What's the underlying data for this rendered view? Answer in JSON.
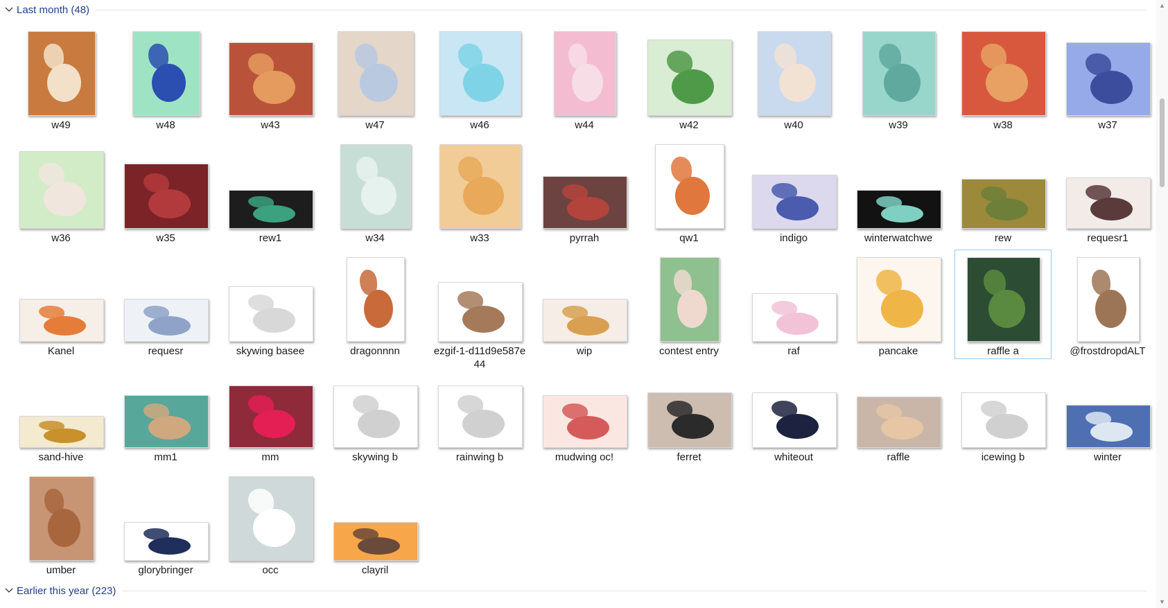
{
  "groups": [
    {
      "label": "Last month (48)"
    },
    {
      "label": "Earlier this year (223)"
    }
  ],
  "icons": {
    "group_toggle": "chevron-down-icon",
    "scroll_up": "chevron-up-icon",
    "scroll_down": "chevron-down-icon"
  },
  "selected_item": "raffle a",
  "items": [
    {
      "name": "w49",
      "bg": "#c97a3f",
      "fg": "#f2e0c8",
      "w": 98,
      "h": 122
    },
    {
      "name": "w48",
      "bg": "#9ee3c4",
      "fg": "#2a4fb0",
      "w": 98,
      "h": 122
    },
    {
      "name": "w43",
      "bg": "#b8533a",
      "fg": "#e59a5e",
      "w": 122,
      "h": 106
    },
    {
      "name": "w47",
      "bg": "#e4d6c8",
      "fg": "#b9c9e0",
      "w": 110,
      "h": 122
    },
    {
      "name": "w46",
      "bg": "#c8e6f4",
      "fg": "#7fd3e6",
      "w": 118,
      "h": 122
    },
    {
      "name": "w44",
      "bg": "#f3bcd0",
      "fg": "#f7dde6",
      "w": 90,
      "h": 122
    },
    {
      "name": "w42",
      "bg": "#d9ecd4",
      "fg": "#4f9a48",
      "w": 122,
      "h": 110
    },
    {
      "name": "w40",
      "bg": "#c9d9ee",
      "fg": "#f1e2d4",
      "w": 106,
      "h": 122
    },
    {
      "name": "w39",
      "bg": "#98d6cb",
      "fg": "#5fa99f",
      "w": 106,
      "h": 122
    },
    {
      "name": "w38",
      "bg": "#d8583e",
      "fg": "#e8a163",
      "w": 122,
      "h": 122
    },
    {
      "name": "w37",
      "bg": "#96a9e8",
      "fg": "#3d4d9e",
      "w": 122,
      "h": 106
    },
    {
      "name": "w36",
      "bg": "#d3ecc8",
      "fg": "#f0e6de",
      "w": 122,
      "h": 112
    },
    {
      "name": "w35",
      "bg": "#7c2327",
      "fg": "#b33a3c",
      "w": 122,
      "h": 94
    },
    {
      "name": "rew1",
      "bg": "#1d1d1d",
      "fg": "#3ba17e",
      "w": 122,
      "h": 56
    },
    {
      "name": "w34",
      "bg": "#c7ded7",
      "fg": "#e6f2ee",
      "w": 102,
      "h": 122
    },
    {
      "name": "w33",
      "bg": "#f2cc96",
      "fg": "#e8a95a",
      "w": 118,
      "h": 122
    },
    {
      "name": "pyrrah",
      "bg": "#6d4342",
      "fg": "#b3443c",
      "w": 122,
      "h": 76
    },
    {
      "name": "qw1",
      "bg": "#ffffff",
      "fg": "#e0773c",
      "w": 100,
      "h": 122
    },
    {
      "name": "indigo",
      "bg": "#dcd9ee",
      "fg": "#4b5cae",
      "w": 122,
      "h": 78
    },
    {
      "name": "winterwatchwe",
      "bg": "#121212",
      "fg": "#7fd0c2",
      "w": 122,
      "h": 56
    },
    {
      "name": "rew",
      "bg": "#9c8a3a",
      "fg": "#6e7f3a",
      "w": 122,
      "h": 72
    },
    {
      "name": "requesr1",
      "bg": "#f2ebe8",
      "fg": "#5a3a3a",
      "w": 122,
      "h": 74
    },
    {
      "name": "Kanel",
      "bg": "#f5efe8",
      "fg": "#e67c3a",
      "w": 122,
      "h": 62
    },
    {
      "name": "requesr",
      "bg": "#eef2f7",
      "fg": "#8ea3c7",
      "w": 122,
      "h": 62
    },
    {
      "name": "skywing basee",
      "bg": "#ffffff",
      "fg": "#d8d8d8",
      "w": 122,
      "h": 80
    },
    {
      "name": "dragonnnn",
      "bg": "#ffffff",
      "fg": "#c86a3a",
      "w": 84,
      "h": 122
    },
    {
      "name": "ezgif-1-d11d9e587e44",
      "bg": "#ffffff",
      "fg": "#a47a5a",
      "w": 122,
      "h": 86
    },
    {
      "name": "wip",
      "bg": "#f6eee6",
      "fg": "#d8a050",
      "w": 122,
      "h": 62
    },
    {
      "name": "contest entry",
      "bg": "#8fc08f",
      "fg": "#efd9cf",
      "w": 86,
      "h": 122
    },
    {
      "name": "raf",
      "bg": "#ffffff",
      "fg": "#f2c2d6",
      "w": 122,
      "h": 70
    },
    {
      "name": "pancake",
      "bg": "#fdf6ee",
      "fg": "#f0b547",
      "w": 122,
      "h": 122
    },
    {
      "name": "raffle a",
      "bg": "#2c4d34",
      "fg": "#5a8a3f",
      "w": 106,
      "h": 122
    },
    {
      "name": "@frostdropdALT",
      "bg": "#ffffff",
      "fg": "#9c7556",
      "w": 90,
      "h": 122
    },
    {
      "name": "sand-hive",
      "bg": "#f3ead0",
      "fg": "#c8912c",
      "w": 122,
      "h": 46
    },
    {
      "name": "mm1",
      "bg": "#57a79a",
      "fg": "#cfa880",
      "w": 122,
      "h": 76
    },
    {
      "name": "mm",
      "bg": "#8f2a3a",
      "fg": "#e31f54",
      "w": 122,
      "h": 90
    },
    {
      "name": "skywing b",
      "bg": "#ffffff",
      "fg": "#d0d0d0",
      "w": 122,
      "h": 90
    },
    {
      "name": "rainwing b",
      "bg": "#ffffff",
      "fg": "#d0d0d0",
      "w": 122,
      "h": 90
    },
    {
      "name": "mudwing oc!",
      "bg": "#fbe7e2",
      "fg": "#d55b5b",
      "w": 122,
      "h": 76
    },
    {
      "name": "ferret",
      "bg": "#cdbdb1",
      "fg": "#2b2b2b",
      "w": 122,
      "h": 80
    },
    {
      "name": "whiteout",
      "bg": "#ffffff",
      "fg": "#1d2240",
      "w": 122,
      "h": 80
    },
    {
      "name": "raffle",
      "bg": "#c9b6a9",
      "fg": "#e6c6a4",
      "w": 122,
      "h": 74
    },
    {
      "name": "icewing b",
      "bg": "#ffffff",
      "fg": "#d0d0d0",
      "w": 122,
      "h": 80
    },
    {
      "name": "winter",
      "bg": "#4e6fb2",
      "fg": "#dde7f2",
      "w": 122,
      "h": 62
    },
    {
      "name": "umber",
      "bg": "#c79574",
      "fg": "#a8663e",
      "w": 94,
      "h": 122
    },
    {
      "name": "glorybringer",
      "bg": "#ffffff",
      "fg": "#1f2e5a",
      "w": 122,
      "h": 56
    },
    {
      "name": "occ",
      "bg": "#cfd9d9",
      "fg": "#ffffff",
      "w": 122,
      "h": 122
    },
    {
      "name": "clayril",
      "bg": "#f7a64a",
      "fg": "#6a4a3a",
      "w": 122,
      "h": 56
    }
  ]
}
